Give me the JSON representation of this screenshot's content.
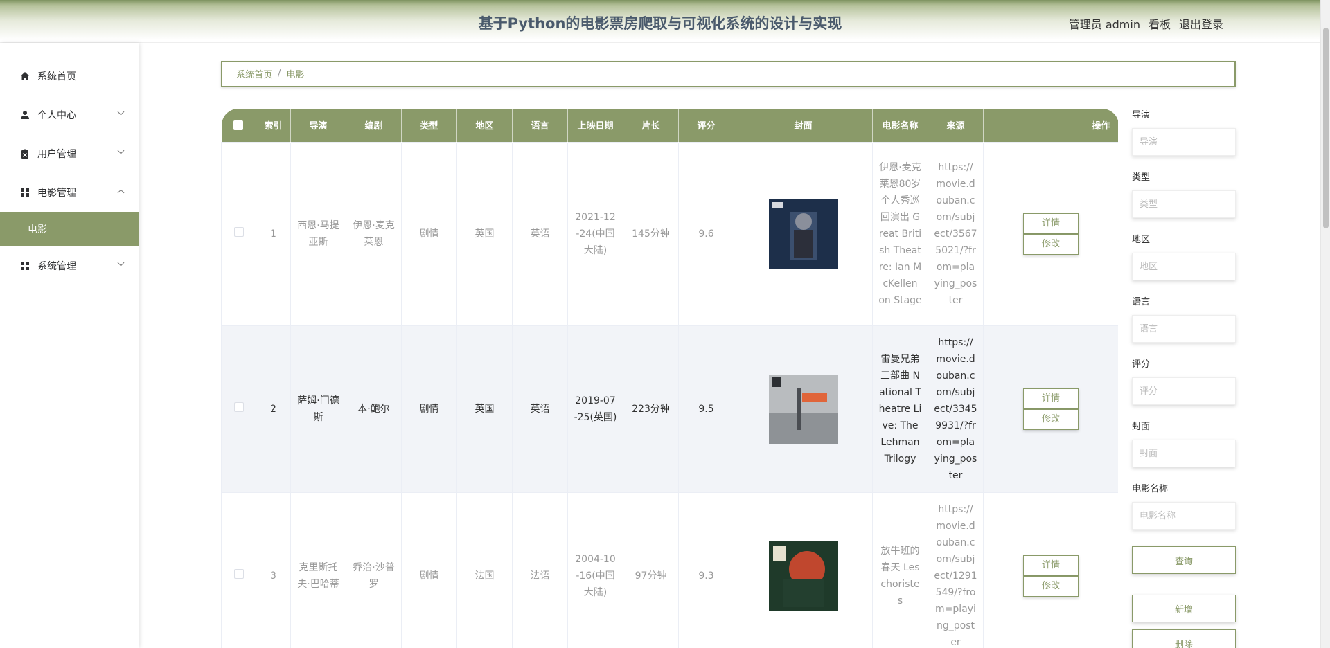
{
  "header": {
    "title": "基于Python的电影票房爬取与可视化系统的设计与实现",
    "user_label": "管理员 admin",
    "board_link": "看板",
    "logout_link": "退出登录"
  },
  "sidebar": {
    "items": [
      {
        "label": "系统首页",
        "icon": "home-icon"
      },
      {
        "label": "个人中心",
        "icon": "user-icon"
      },
      {
        "label": "用户管理",
        "icon": "clipboard-icon"
      },
      {
        "label": "电影管理",
        "icon": "grid-icon"
      },
      {
        "label": "系统管理",
        "icon": "grid-icon"
      }
    ],
    "sub_item": "电影"
  },
  "breadcrumb": {
    "home": "系统首页",
    "separator": "/",
    "current": "电影"
  },
  "table": {
    "columns": [
      "索引",
      "导演",
      "编剧",
      "类型",
      "地区",
      "语言",
      "上映日期",
      "片长",
      "评分",
      "封面",
      "电影名称",
      "来源",
      "操作"
    ],
    "detail_label": "详情",
    "edit_label": "修改",
    "rows": [
      {
        "index": "1",
        "director": "西恩·马提亚斯",
        "writer": "伊恩·麦克莱恩",
        "genre": "剧情",
        "region": "英国",
        "language": "英语",
        "release": "2021-12-24(中国大陆)",
        "duration": "145分钟",
        "rating": "9.6",
        "title": "伊恩·麦克莱恩80岁个人秀巡回演出 Great British Theatre: Ian McKellen on Stage",
        "source": "https://movie.douban.com/subject/35675021/?from=playing_poster"
      },
      {
        "index": "2",
        "director": "萨姆·门德斯",
        "writer": "本·鲍尔",
        "genre": "剧情",
        "region": "英国",
        "language": "英语",
        "release": "2019-07-25(英国)",
        "duration": "223分钟",
        "rating": "9.5",
        "title": "雷曼兄弟三部曲 National Theatre Live: The Lehman Trilogy",
        "source": "https://movie.douban.com/subject/33459931/?from=playing_poster"
      },
      {
        "index": "3",
        "director": "克里斯托夫·巴哈蒂",
        "writer": "乔治·沙普罗",
        "genre": "剧情",
        "region": "法国",
        "language": "法语",
        "release": "2004-10-16(中国大陆)",
        "duration": "97分钟",
        "rating": "9.3",
        "title": "放牛班的春天 Les choristes",
        "source": "https://movie.douban.com/subject/1291549/?from=playing_poster"
      }
    ]
  },
  "search": {
    "director_label": "导演",
    "director_placeholder": "导演",
    "genre_label": "类型",
    "genre_placeholder": "类型",
    "region_label": "地区",
    "region_placeholder": "地区",
    "language_label": "语言",
    "language_placeholder": "语言",
    "rating_label": "评分",
    "rating_placeholder": "评分",
    "cover_label": "封面",
    "cover_placeholder": "封面",
    "title_label": "电影名称",
    "title_placeholder": "电影名称",
    "query_button": "查询",
    "add_button": "新增",
    "delete_button": "删除"
  },
  "colors": {
    "accent": "#8a9a69",
    "header_text": "#4a5a6c"
  }
}
